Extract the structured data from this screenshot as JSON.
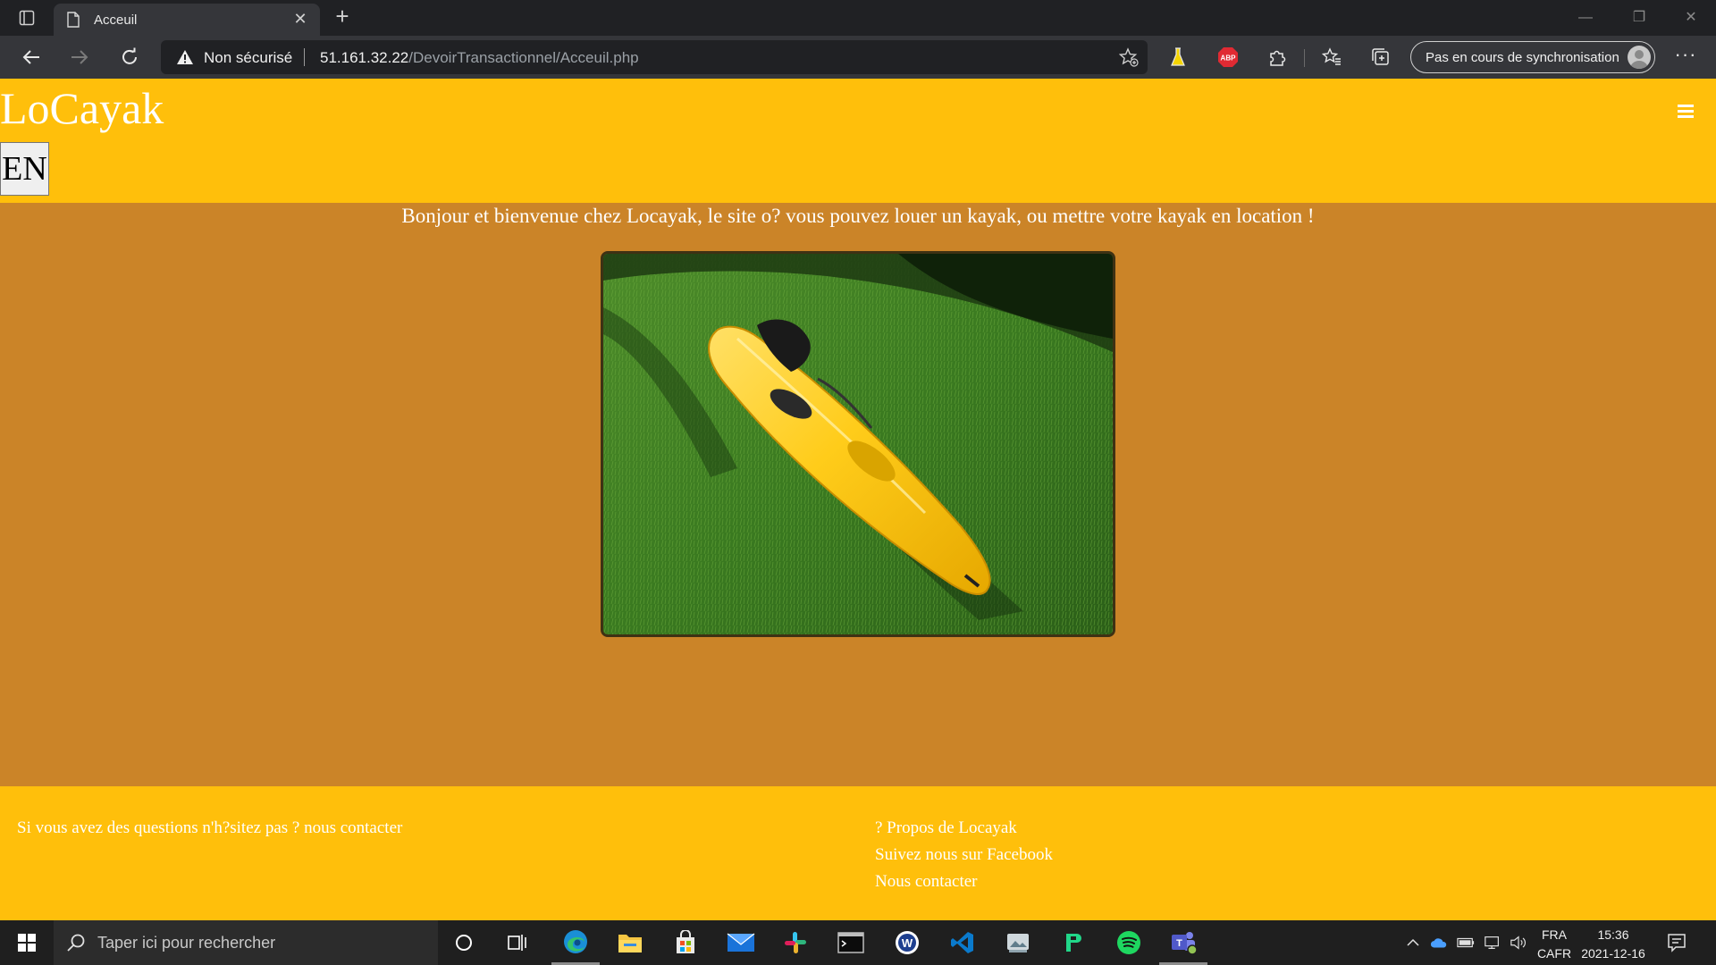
{
  "browser": {
    "tab_title": "Acceuil",
    "not_secure_label": "Non sécurisé",
    "url_host": "51.161.32.22",
    "url_path": "/DevoirTransactionnel/Acceuil.php",
    "sync_label": "Pas en cours de synchronisation",
    "extensions": [
      "flask-icon",
      "adblock-plus-icon",
      "puzzle-icon"
    ],
    "abp_text": "ABP"
  },
  "site": {
    "brand": "LoCayak",
    "lang_button": "EN",
    "welcome": "Bonjour et bienvenue chez Locayak, le site o? vous pouvez louer un kayak, ou mettre votre kayak en location !",
    "footer": {
      "contact_text": "Si vous avez des questions n'h?sitez pas ? nous contacter",
      "links": [
        "? Propos de Locayak",
        "Suivez nous sur Facebook",
        "Nous contacter"
      ]
    },
    "colors": {
      "header": "#ffbf0b",
      "body": "#cb8428",
      "text": "#ffffff"
    }
  },
  "taskbar": {
    "search_placeholder": "Taper ici pour rechercher",
    "apps": [
      "cortana-icon",
      "task-view-icon",
      "edge-icon",
      "file-explorer-icon",
      "store-icon",
      "mail-icon",
      "slack-icon",
      "terminal-icon",
      "word-icon",
      "vscode-icon",
      "photos-icon",
      "pycharm-icon",
      "spotify-icon",
      "teams-icon"
    ],
    "language_line1": "FRA",
    "language_line2": "CAFR",
    "time": "15:36",
    "date": "2021-12-16"
  }
}
